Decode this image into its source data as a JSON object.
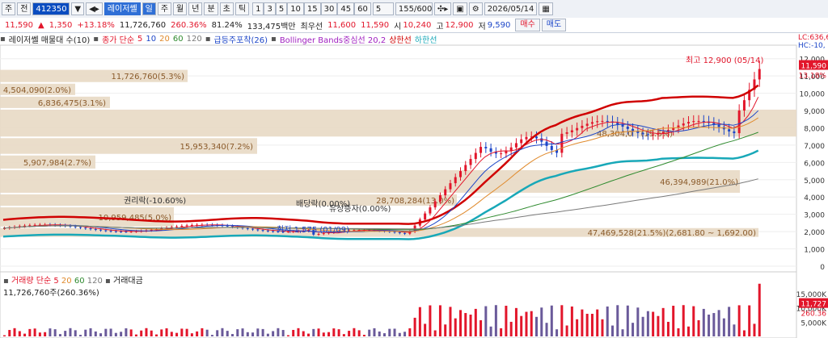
{
  "toolbar": {
    "market": "주",
    "period": "전",
    "code": "412350",
    "name": "레이저쎌",
    "tabs": [
      "일",
      "주",
      "월",
      "년",
      "분",
      "초",
      "틱"
    ],
    "intervals": [
      "1",
      "3",
      "5",
      "10",
      "15",
      "30",
      "45",
      "60"
    ],
    "interval_value": "5",
    "count": "155/600",
    "date": "2026/05/14"
  },
  "quote": {
    "price": "11,590",
    "change": "1,350",
    "change_pct": "+13.18%",
    "volume": "11,726,760",
    "vol_pct": "260.36%",
    "ratio": "81.24%",
    "amount": "133,475백만",
    "best_label": "최우선",
    "best_ask": "11,600",
    "best_bid": "11,590",
    "open_label": "시",
    "open": "10,240",
    "high_label": "고",
    "high": "12,900",
    "low_label": "저",
    "low": "9,590",
    "buy": "매수",
    "sell": "매도"
  },
  "legend": {
    "name": "레이저쎌 매물대 수(10)",
    "ma": "종가 단순",
    "ma_values": [
      "5",
      "10",
      "20",
      "60",
      "120"
    ],
    "pattern": "급등주포착(26)",
    "bb": "Bollinger Bands중심선 20,2",
    "upper": "상한선",
    "lower": "하한선",
    "right1": "LC:636,6",
    "right2": "HC:-10,"
  },
  "colors": {
    "up": "#e2162b",
    "down": "#1c46c8",
    "volume_bar": "#e8d9c4",
    "ma5": "#e2162b",
    "ma10": "#1c46c8",
    "ma20": "#e08a2c",
    "ma60": "#2e8a2e",
    "ma120": "#7a7a7a",
    "bb_upper": "#d00000",
    "bb_lower": "#18a8b8"
  },
  "chart_data": {
    "type": "candlestick",
    "y_axis_labels": [
      "12,000",
      "11,000",
      "10,000",
      "9,000",
      "8,000",
      "7,000",
      "6,000",
      "5,000",
      "4,000",
      "3,000",
      "2,000",
      "1,000",
      "0"
    ],
    "y_axis_values": [
      12000,
      11000,
      10000,
      9000,
      8000,
      7000,
      6000,
      5000,
      4000,
      3000,
      2000,
      1000,
      0
    ],
    "ylim": [
      0,
      12500
    ],
    "current_label": "11,590",
    "current_pct": "13.18%",
    "current_value": 11590,
    "profile_bins": [
      {
        "label": "11,726,760(5.3%)",
        "low": 10600,
        "high": 11400
      },
      {
        "label": "4,504,090(2.0%)",
        "low": 9850,
        "high": 10600
      },
      {
        "label": "6,836,475(3.1%)",
        "low": 9100,
        "high": 9850
      },
      {
        "label": "(19.6%)",
        "low": 7450,
        "high": 9100
      },
      {
        "label": "15,953,340(7.2%)",
        "low": 6450,
        "high": 7450
      },
      {
        "label": "5,907,984(2.7%)",
        "low": 5600,
        "high": 6450
      },
      {
        "label": "46,394,989(21.0%)",
        "low": 4200,
        "high": 5600
      },
      {
        "label": "28,708,284(13.0%)",
        "low": 3450,
        "high": 4200
      },
      {
        "label": "10,959,485(5.0%)",
        "low": 2250,
        "high": 3450
      },
      {
        "label": "47,469,528(21.5%)(2,681.80 ~ 1,692.00)",
        "low": 1650,
        "high": 2250
      }
    ],
    "annotations": {
      "high": "최고 12,900 (05/14)",
      "low": "최저 1,575 (01/09)",
      "rights": "권리락(-10.60%)",
      "dividend": "배당락(0.00%)",
      "bonus": "유상증자(0.00%)",
      "poc_partial": "48,304,0"
    },
    "volume": {
      "label_prefix": "거래량 단순",
      "ma_values": [
        "5",
        "20",
        "60",
        "120"
      ],
      "amount_label": "거래대금",
      "value_text": "11,726,760주(260.36%)",
      "y_labels": [
        "15,000K",
        "10,000K",
        "5,000K"
      ],
      "y_values": [
        15000,
        10000,
        5000
      ],
      "current_text": "11,727",
      "current_pct": "260.36",
      "ylim": [
        0,
        19000
      ]
    }
  }
}
